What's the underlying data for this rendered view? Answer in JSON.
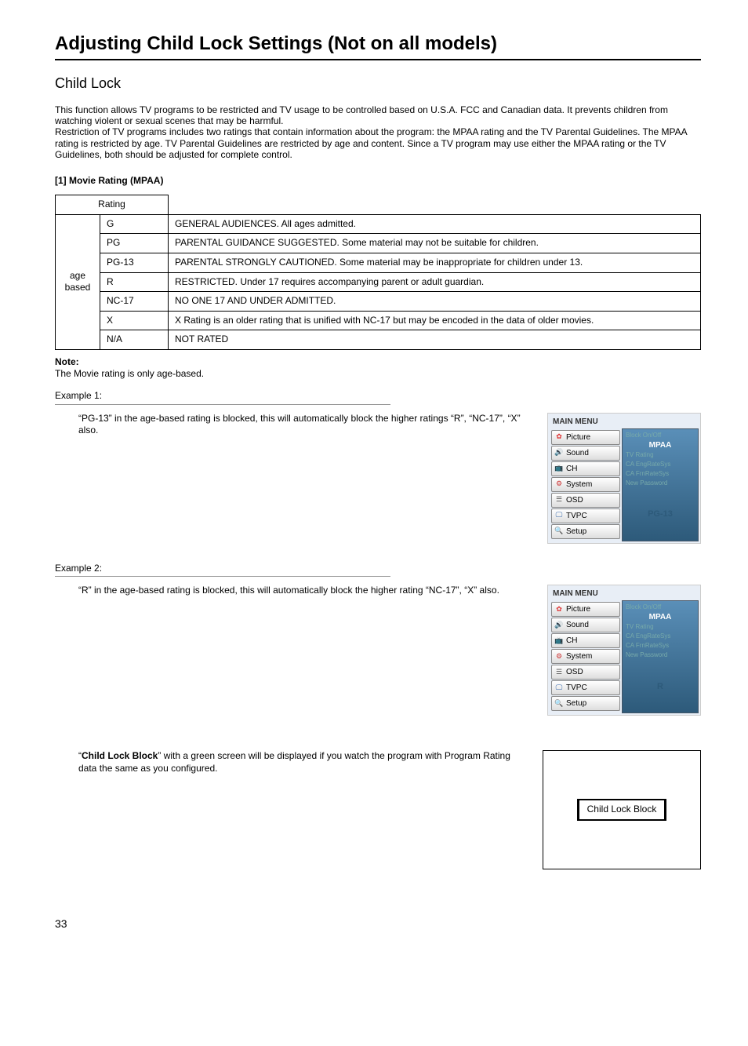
{
  "page_title": "Adjusting Child Lock Settings (Not on all models)",
  "section_title": "Child Lock",
  "intro": "This function allows TV programs to be restricted and TV usage to be controlled based on U.S.A. FCC and Canadian data. It prevents children from watching violent or sexual scenes that may be harmful.\nRestriction of TV programs includes two ratings that contain information about the program: the MPAA rating and the TV Parental Guidelines. The MPAA rating is restricted by age. TV Parental Guidelines are restricted by age and content. Since a TV program may use either the MPAA rating or the TV Guidelines, both should be adjusted for complete control.",
  "movie_rating_title": "[1] Movie Rating (MPAA)",
  "table": {
    "header_rating": "Rating",
    "side_label": "age\nbased",
    "rows": [
      {
        "code": "G",
        "desc": "GENERAL AUDIENCES. All ages admitted."
      },
      {
        "code": "PG",
        "desc": "PARENTAL GUIDANCE SUGGESTED. Some material may not be suitable for children."
      },
      {
        "code": "PG-13",
        "desc": "PARENTAL STRONGLY CAUTIONED. Some material may be inappropriate for children under 13."
      },
      {
        "code": "R",
        "desc": "RESTRICTED. Under 17 requires accompanying parent or adult guardian."
      },
      {
        "code": "NC-17",
        "desc": "NO ONE 17 AND UNDER ADMITTED."
      },
      {
        "code": "X",
        "desc": "X Rating is an older rating that is unified with NC-17 but may be encoded in the data of older movies."
      },
      {
        "code": "N/A",
        "desc": "NOT RATED"
      }
    ]
  },
  "note_label": "Note:",
  "note_text": "The Movie rating is only age-based.",
  "example1_label": "Example 1:",
  "example1_text": "“PG-13” in the age-based rating is blocked, this will automatically block the higher ratings “R”, “NC-17”, “X” also.",
  "example2_label": "Example 2:",
  "example2_text": "“R” in the age-based rating is blocked, this will automatically block the higher rating “NC-17”, “X” also.",
  "menu": {
    "title": "MAIN MENU",
    "items": [
      "Picture",
      "Sound",
      "CH",
      "System",
      "OSD",
      "TVPC",
      "Setup"
    ],
    "right_lines": [
      "Block On/Off",
      "TV Rating",
      "CA EngRateSys",
      "CA FrnRateSys",
      "New Password"
    ],
    "mpaa": "MPAA",
    "badge1": "PG-13",
    "badge2": "R"
  },
  "lock_text_prefix": "“",
  "lock_text_bold": "Child Lock Block",
  "lock_text_suffix": "” with a green screen will be displayed if you watch the program with Program Rating data the same as you configured.",
  "lock_box": "Child Lock Block",
  "page_num": "33"
}
